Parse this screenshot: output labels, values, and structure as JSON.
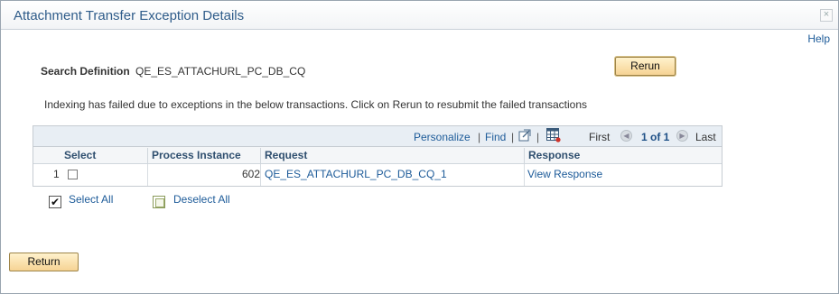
{
  "dialog": {
    "title": "Attachment Transfer Exception Details",
    "close_glyph": "×",
    "help_label": "Help"
  },
  "search": {
    "label": "Search Definition",
    "value": "QE_ES_ATTACHURL_PC_DB_CQ"
  },
  "buttons": {
    "rerun_label": "Rerun",
    "return_label": "Return"
  },
  "message": "Indexing has failed due to exceptions in the below transactions. Click on Rerun to resubmit the failed transactions",
  "grid": {
    "personalize_label": "Personalize",
    "find_label": "Find",
    "separator": "|",
    "first_label": "First",
    "page_label": "1 of 1",
    "last_label": "Last",
    "prev_glyph": "◀",
    "next_glyph": "▶",
    "columns": {
      "select": "Select",
      "process_instance": "Process Instance",
      "request": "Request",
      "response": "Response"
    },
    "rows": [
      {
        "row_number": "1",
        "selected": false,
        "process_instance": "602",
        "request": "QE_ES_ATTACHURL_PC_DB_CQ_1",
        "response": "View Response"
      }
    ]
  },
  "selection": {
    "select_all_label": "Select All",
    "select_all_check": "✔",
    "deselect_all_label": "Deselect All"
  },
  "icons": [
    "close-icon",
    "new-window-icon",
    "grid-download-icon",
    "prev-arrow-icon",
    "next-arrow-icon",
    "checkbox-checked-icon",
    "checkbox-empty-icon"
  ],
  "colors": {
    "link": "#1d5b99",
    "title": "#2f5c8a",
    "button_fill": "#f6d394",
    "grid_header": "#e8eef4"
  }
}
